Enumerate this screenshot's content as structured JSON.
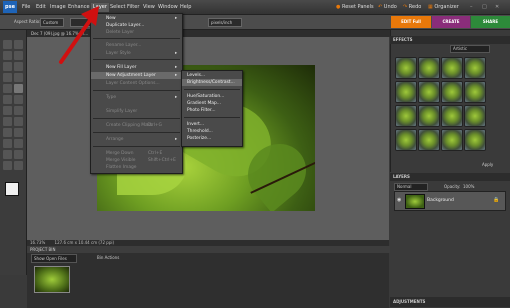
{
  "app": {
    "logo": "pse"
  },
  "menubar": {
    "items": [
      "File",
      "Edit",
      "Image",
      "Enhance",
      "Layer",
      "Select",
      "Filter",
      "View",
      "Window",
      "Help"
    ],
    "right": [
      "Reset Panels",
      "Undo",
      "Redo",
      "Organizer"
    ]
  },
  "options": {
    "aspect_label": "Aspect Ratio:",
    "aspect_value": "Custom",
    "resolution_value": "pixels/inch",
    "modes": [
      "EDIT Full",
      "CREATE",
      "SHARE"
    ]
  },
  "document": {
    "tab": "Dec 7 (09).jpg @ 16.7% (R…",
    "status_zoom": "16.73%",
    "status_dims": "127.6 cm x 10.44 cm (72 ppi)"
  },
  "project_bin": {
    "title": "PROJECT BIN",
    "dropdown": "Show Open Files",
    "actions_tab": "Bin Actions"
  },
  "effects": {
    "title": "EFFECTS",
    "filter": "Artistic",
    "apply": "Apply"
  },
  "layers": {
    "title": "LAYERS",
    "blend": "Normal",
    "opacity_label": "Opacity:",
    "opacity_value": "100%",
    "layer_name": "Background"
  },
  "adjustments": {
    "title": "ADJUSTMENTS"
  },
  "layer_menu": {
    "items": [
      {
        "label": "New",
        "disabled": false,
        "submenu": true
      },
      {
        "label": "Duplicate Layer...",
        "disabled": false
      },
      {
        "label": "Delete Layer",
        "disabled": true
      },
      {
        "label": "Rename Layer...",
        "disabled": true
      },
      {
        "label": "Layer Style",
        "disabled": true,
        "submenu": true
      },
      {
        "label": "New Fill Layer",
        "disabled": false,
        "submenu": true
      },
      {
        "label": "New Adjustment Layer",
        "disabled": false,
        "submenu": true,
        "highlight": true
      },
      {
        "label": "Layer Content Options...",
        "disabled": true
      },
      {
        "label": "Type",
        "disabled": true,
        "submenu": true
      },
      {
        "label": "Simplify Layer",
        "disabled": true
      },
      {
        "label": "Create Clipping Mask",
        "disabled": true,
        "shortcut": "Ctrl+G"
      },
      {
        "label": "Arrange",
        "disabled": true,
        "submenu": true
      },
      {
        "label": "Merge Down",
        "disabled": true,
        "shortcut": "Ctrl+E"
      },
      {
        "label": "Merge Visible",
        "disabled": true,
        "shortcut": "Shift+Ctrl+E"
      },
      {
        "label": "Flatten Image",
        "disabled": true
      }
    ]
  },
  "adjustment_submenu": {
    "items": [
      {
        "label": "Levels...",
        "highlight": false
      },
      {
        "label": "Brightness/Contrast...",
        "highlight": true
      },
      {
        "label": "Hue/Saturation...",
        "highlight": false
      },
      {
        "label": "Gradient Map...",
        "highlight": false
      },
      {
        "label": "Photo Filter...",
        "highlight": false
      },
      {
        "label": "Invert...",
        "highlight": false
      },
      {
        "label": "Threshold...",
        "highlight": false
      },
      {
        "label": "Posterize...",
        "highlight": false
      }
    ]
  },
  "colors": {
    "accent_red": "#d01010",
    "edit_orange": "#e8780a",
    "create_purple": "#8a2d7a",
    "share_green": "#2d8a3a"
  }
}
